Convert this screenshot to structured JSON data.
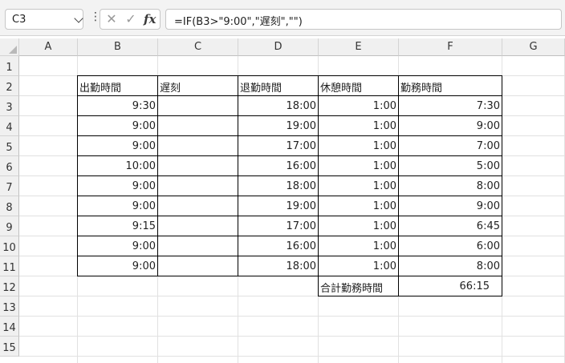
{
  "formula_bar": {
    "name_box": "C3",
    "cancel_glyph": "✕",
    "enter_glyph": "✓",
    "fx_label": "fx",
    "formula": "=IF(B3>\"9:00\",\"遅刻\",\"\")"
  },
  "columns": [
    "A",
    "B",
    "C",
    "D",
    "E",
    "F",
    "G"
  ],
  "rows": [
    "1",
    "2",
    "3",
    "4",
    "5",
    "6",
    "7",
    "8",
    "9",
    "10",
    "11",
    "12",
    "13",
    "14",
    "15"
  ],
  "table": {
    "headers": [
      "出勤時間",
      "遅刻",
      "退勤時間",
      "休憩時間",
      "勤務時間"
    ],
    "rows": [
      [
        "9:30",
        "",
        "18:00",
        "1:00",
        "7:30"
      ],
      [
        "9:00",
        "",
        "19:00",
        "1:00",
        "9:00"
      ],
      [
        "9:00",
        "",
        "17:00",
        "1:00",
        "7:00"
      ],
      [
        "10:00",
        "",
        "16:00",
        "1:00",
        "5:00"
      ],
      [
        "9:00",
        "",
        "18:00",
        "1:00",
        "8:00"
      ],
      [
        "9:00",
        "",
        "19:00",
        "1:00",
        "9:00"
      ],
      [
        "9:15",
        "",
        "17:00",
        "1:00",
        "6:45"
      ],
      [
        "9:00",
        "",
        "16:00",
        "1:00",
        "6:00"
      ],
      [
        "9:00",
        "",
        "18:00",
        "1:00",
        "8:00"
      ]
    ],
    "total_label": "合計勤務時間",
    "total_value": "66:15"
  }
}
